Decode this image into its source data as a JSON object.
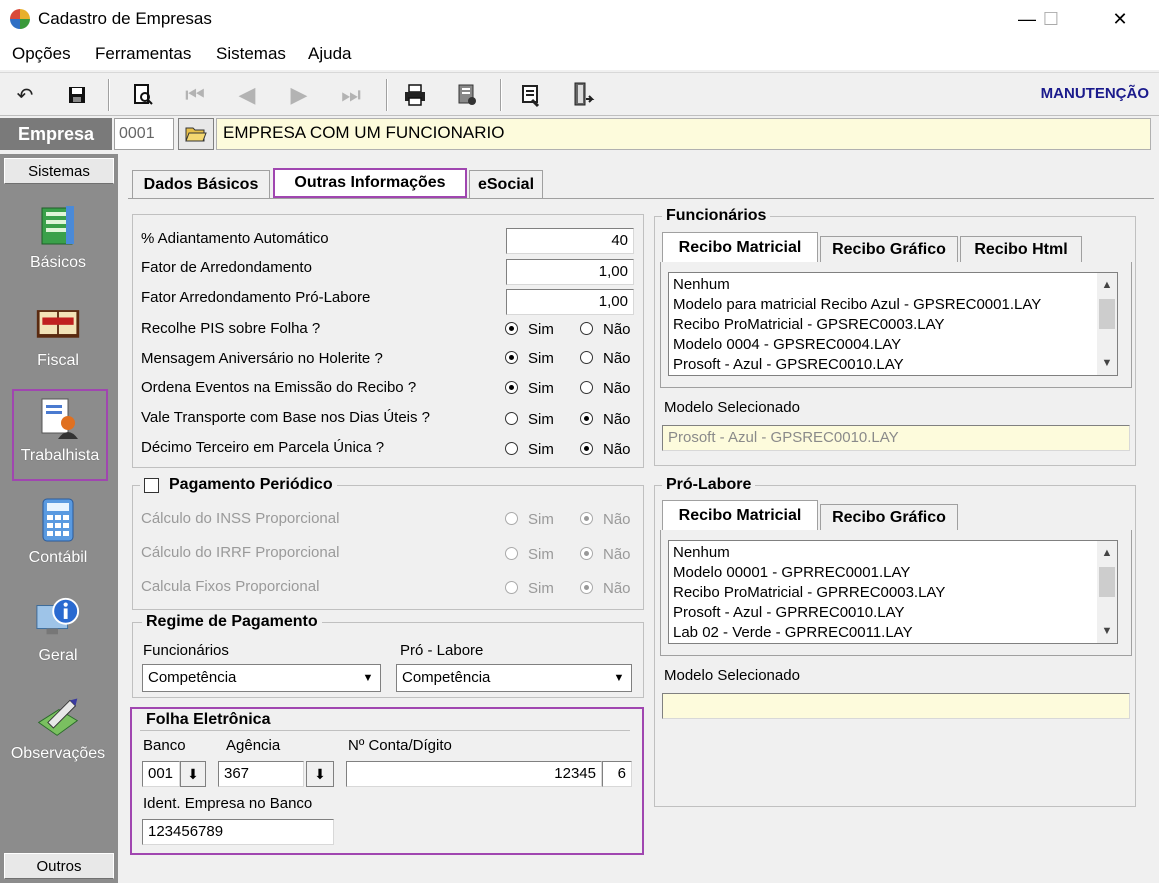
{
  "window": {
    "title": "Cadastro de Empresas",
    "minimize": "—",
    "maximize": "☐",
    "close": "✕"
  },
  "menu": [
    "Opções",
    "Ferramentas",
    "Sistemas",
    "Ajuda"
  ],
  "toolbar": {
    "mode": "MANUTENÇÃO"
  },
  "empresa": {
    "label": "Empresa",
    "code": "0001",
    "name": "EMPRESA COM UM FUNCIONARIO"
  },
  "sidebar": {
    "header": "Sistemas",
    "footer": "Outros",
    "items": [
      {
        "label": "Básicos",
        "icon": "notebook-icon"
      },
      {
        "label": "Fiscal",
        "icon": "book-icon"
      },
      {
        "label": "Trabalhista",
        "icon": "worker-document-icon"
      },
      {
        "label": "Contábil",
        "icon": "calculator-icon"
      },
      {
        "label": "Geral",
        "icon": "info-monitor-icon"
      },
      {
        "label": "Observações",
        "icon": "pen-notes-icon"
      }
    ]
  },
  "tabs": [
    "Dados Básicos",
    "Outras Informações",
    "eSocial"
  ],
  "config": {
    "adiantamento": {
      "label": "% Adiantamento Automático",
      "value": "40"
    },
    "fator": {
      "label": "Fator de Arredondamento",
      "value": "1,00"
    },
    "fator_pro": {
      "label": "Fator Arredondamento Pró-Labore",
      "value": "1,00"
    },
    "sim": "Sim",
    "nao": "Não",
    "questions": [
      {
        "label": "Recolhe PIS sobre Folha ?",
        "value": "Sim"
      },
      {
        "label": "Mensagem Aniversário no Holerite ?",
        "value": "Sim"
      },
      {
        "label": "Ordena Eventos na Emissão do Recibo ?",
        "value": "Sim"
      },
      {
        "label": "Vale Transporte com Base nos Dias Úteis ?",
        "value": "Não"
      },
      {
        "label": "Décimo Terceiro em Parcela Única ?",
        "value": "Não"
      }
    ]
  },
  "pagamento_periodico": {
    "title": "Pagamento Periódico",
    "items": [
      {
        "label": "Cálculo do INSS Proporcional",
        "value": "Não"
      },
      {
        "label": "Cálculo do IRRF Proporcional",
        "value": "Não"
      },
      {
        "label": "Calcula Fixos Proporcional",
        "value": "Não"
      }
    ]
  },
  "regime": {
    "title": "Regime de Pagamento",
    "funcionarios_label": "Funcionários",
    "funcionarios_value": "Competência",
    "pro_label": "Pró - Labore",
    "pro_value": "Competência"
  },
  "folha": {
    "title": "Folha Eletrônica",
    "banco_label": "Banco",
    "banco": "001",
    "agencia_label": "Agência",
    "agencia": "367",
    "conta_label": "Nº Conta/Dígito",
    "conta": "12345",
    "digito": "6",
    "ident_label": "Ident. Empresa no Banco",
    "ident": "123456789"
  },
  "funcionarios": {
    "title": "Funcionários",
    "tabs": [
      "Recibo Matricial",
      "Recibo Gráfico",
      "Recibo Html"
    ],
    "list": [
      "Nenhum",
      "Modelo para matricial Recibo Azul - GPSREC0001.LAY",
      "Recibo ProMatricial - GPSREC0003.LAY",
      "Modelo 0004 - GPSREC0004.LAY",
      "Prosoft - Azul - GPSREC0010.LAY"
    ],
    "selected_label": "Modelo Selecionado",
    "selected": "Prosoft - Azul - GPSREC0010.LAY"
  },
  "prolabore": {
    "title": "Pró-Labore",
    "tabs": [
      "Recibo Matricial",
      "Recibo Gráfico"
    ],
    "list": [
      "Nenhum",
      "Modelo 00001 - GPRREC0001.LAY",
      "Recibo ProMatricial - GPRREC0003.LAY",
      "Prosoft - Azul - GPRREC0010.LAY",
      "Lab 02 - Verde - GPRREC0011.LAY"
    ],
    "selected_label": "Modelo Selecionado",
    "selected": ""
  }
}
